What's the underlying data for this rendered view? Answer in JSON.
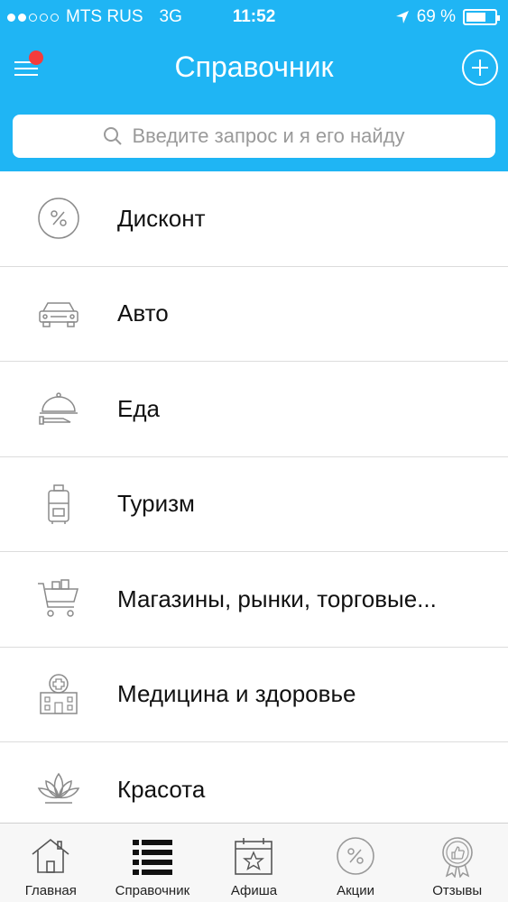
{
  "status_bar": {
    "carrier": "MTS RUS",
    "network": "3G",
    "time": "11:52",
    "battery": "69 %",
    "battery_level": 0.69,
    "signal_bars": 2
  },
  "header": {
    "title": "Справочник",
    "search_placeholder": "Введите запрос и я его найду"
  },
  "categories": [
    {
      "label": "Дисконт",
      "icon": "percent-icon"
    },
    {
      "label": "Авто",
      "icon": "car-icon"
    },
    {
      "label": "Еда",
      "icon": "food-cloche-icon"
    },
    {
      "label": "Туризм",
      "icon": "suitcase-icon"
    },
    {
      "label": "Магазины, рынки, торговые...",
      "icon": "cart-icon"
    },
    {
      "label": "Медицина и здоровье",
      "icon": "hospital-icon"
    },
    {
      "label": "Красота",
      "icon": "lotus-icon"
    }
  ],
  "tabs": [
    {
      "label": "Главная",
      "icon": "home-icon"
    },
    {
      "label": "Справочник",
      "icon": "list-icon",
      "active": true
    },
    {
      "label": "Афиша",
      "icon": "calendar-star-icon"
    },
    {
      "label": "Акции",
      "icon": "percent-icon"
    },
    {
      "label": "Отзывы",
      "icon": "badge-like-icon"
    }
  ],
  "colors": {
    "header_bg": "#1fb5f4",
    "badge": "#f43c3c",
    "icon_gray": "#8a8a8a"
  }
}
